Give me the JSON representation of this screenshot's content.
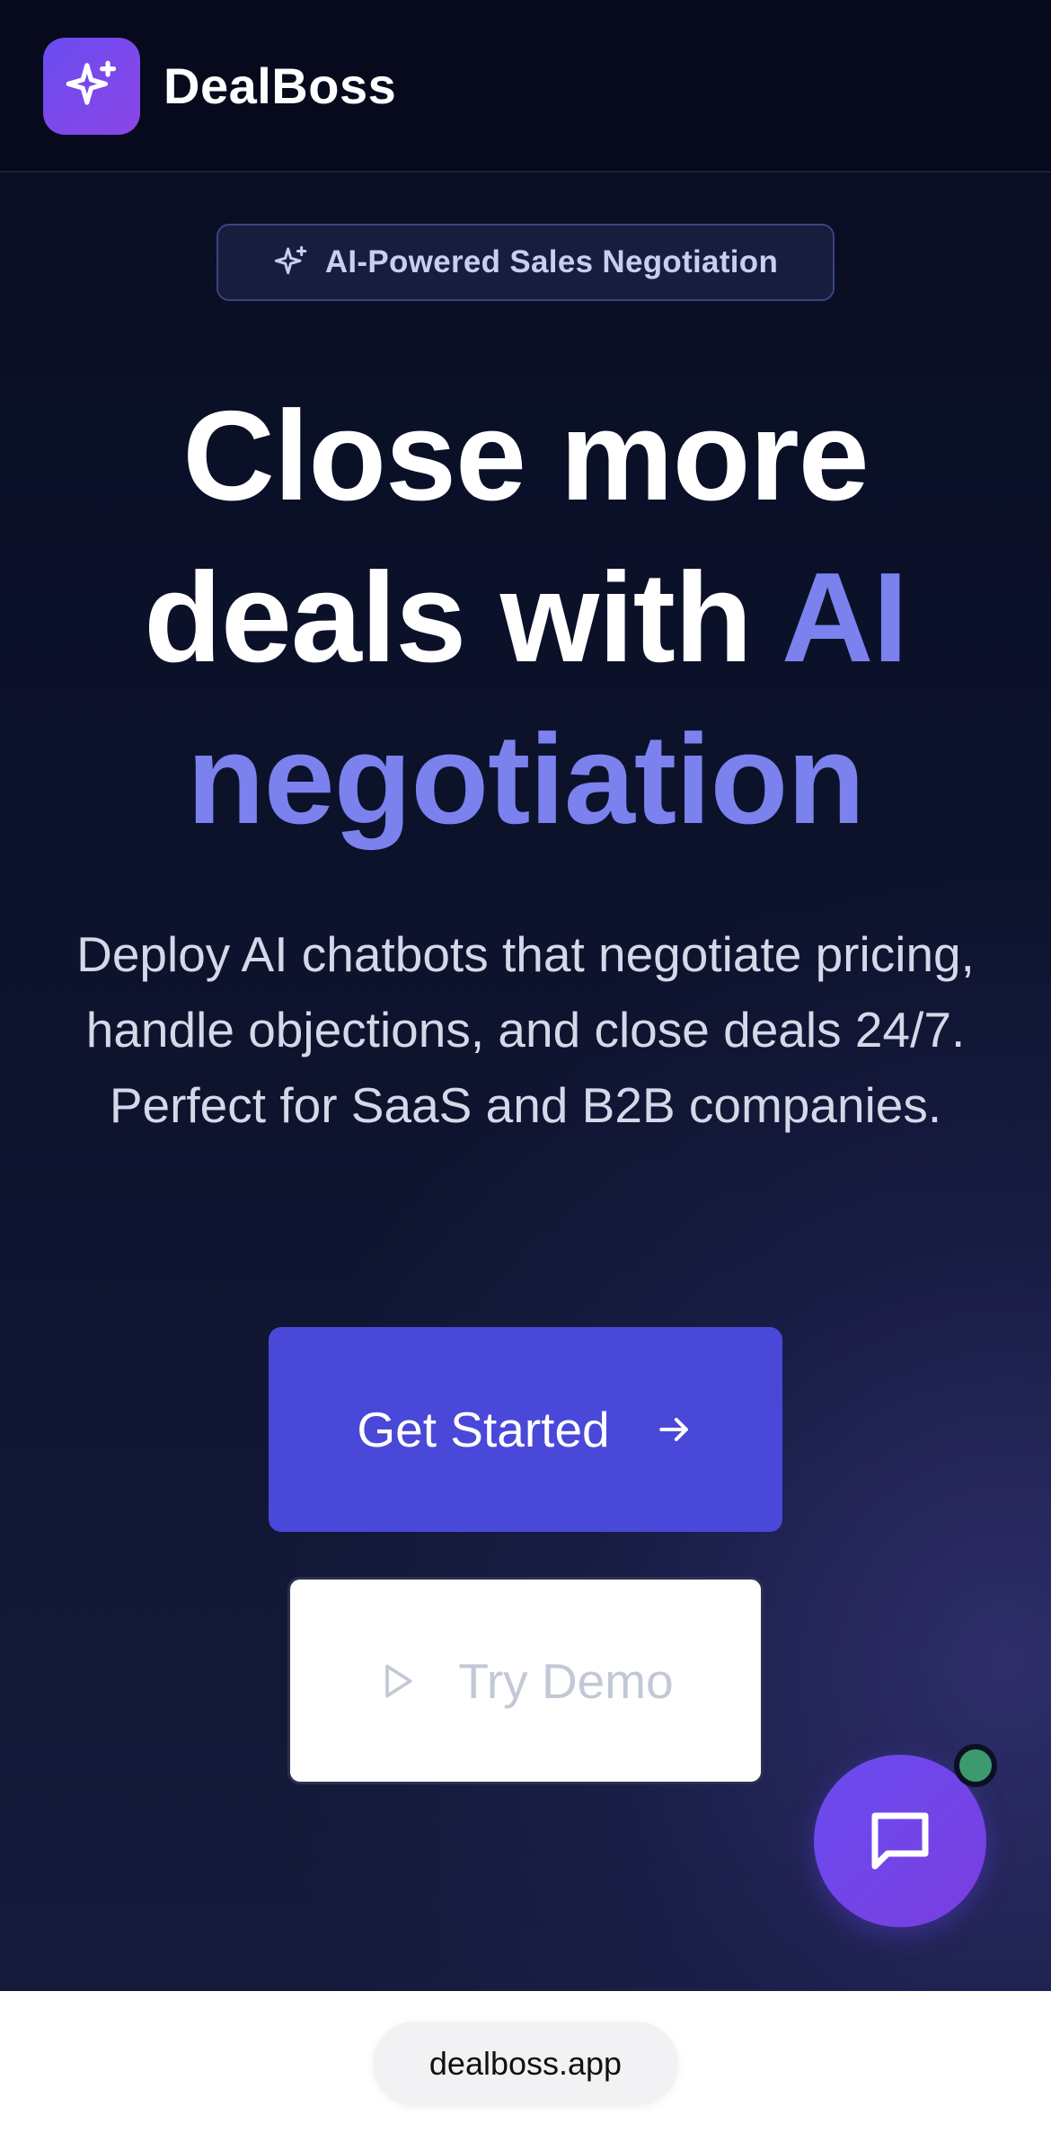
{
  "header": {
    "brand": "DealBoss",
    "logo_icon": "sparkles-icon"
  },
  "hero": {
    "badge_label": "AI-Powered Sales Negotiation",
    "badge_icon": "sparkles-icon",
    "headline_part1": "Close more",
    "headline_part2": "deals with",
    "headline_accent1": "AI",
    "headline_accent2": "negotiation",
    "subtitle": "Deploy AI chatbots that negotiate pricing, handle objections, and close deals 24/7. Perfect for SaaS and B2B companies.",
    "primary_cta": "Get Started",
    "primary_cta_icon": "arrow-right-icon",
    "secondary_cta": "Try Demo",
    "secondary_cta_icon": "play-icon"
  },
  "chat_widget": {
    "icon": "chat-bubble-icon",
    "status": "online"
  },
  "browser": {
    "url": "dealboss.app"
  },
  "colors": {
    "background": "#0a0f26",
    "accent": "#7b82ee",
    "primary_button": "#4a48d8",
    "logo_gradient_start": "#6a4cf0",
    "logo_gradient_end": "#8b45e6",
    "status_online": "#3d9a6f"
  }
}
